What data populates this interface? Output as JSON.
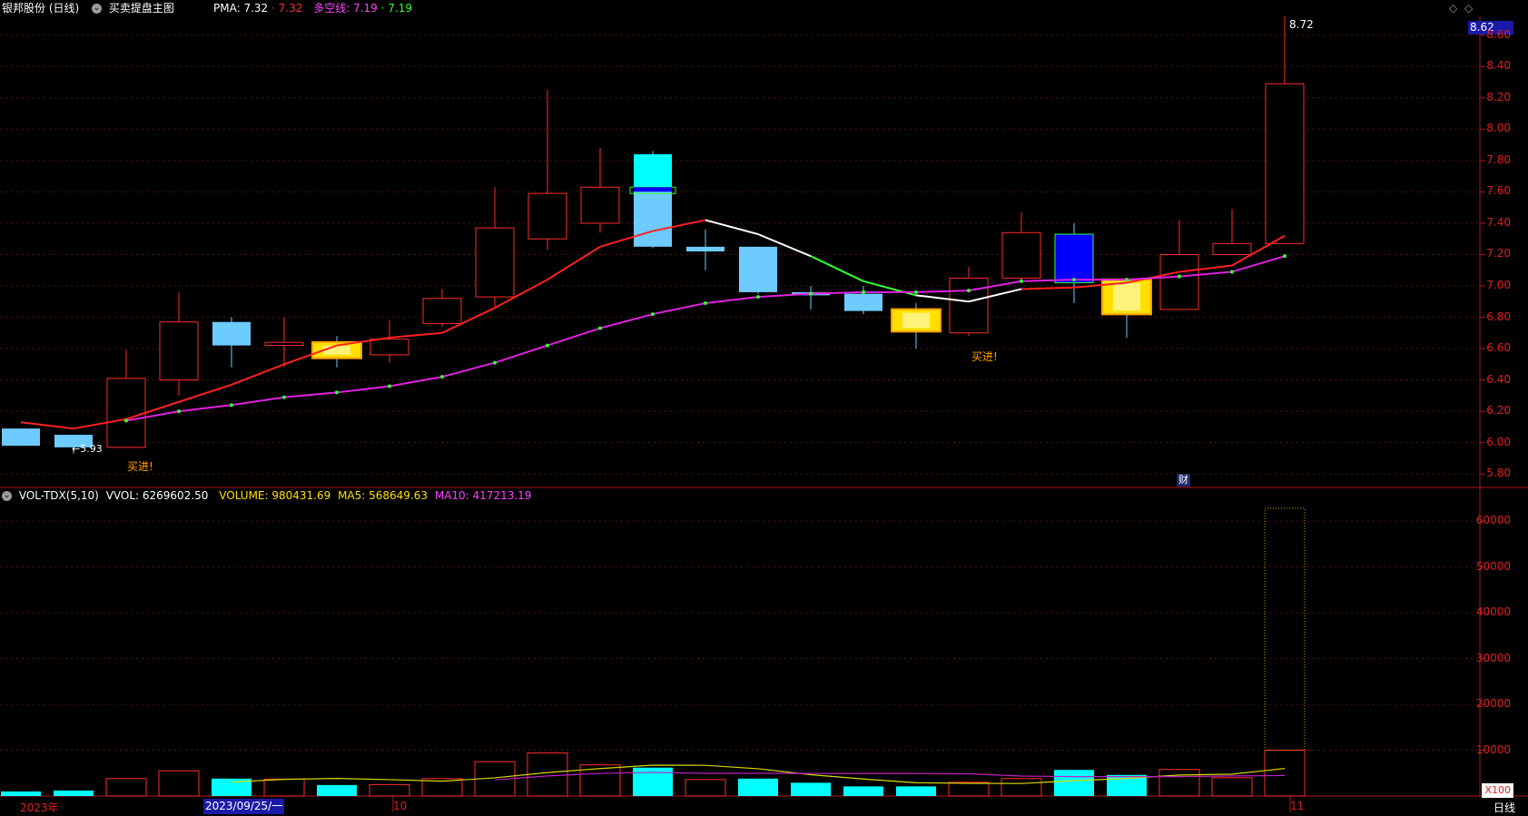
{
  "header": {
    "title": "银邦股份 (日线)",
    "indicator_name": "买卖提盘主图",
    "pma_label": "PMA: 7.32",
    "pma_value": "7.32",
    "dk_label": "多空线: 7.19",
    "dk_value": "7.19"
  },
  "volume_header": {
    "name": "VOL-TDX(5,10)",
    "vvol": "VVOL: 6269602.50",
    "volume": "VOLUME: 980431.69",
    "ma5": "MA5: 568649.63",
    "ma10": "MA10: 417213.19"
  },
  "annotations": {
    "high_label": "8.72",
    "low_label": "←5.93",
    "buy_label": "买进!",
    "cai_label": "财",
    "current_price": "8.62"
  },
  "x_axis": {
    "year_label": "2023年",
    "date_label": "2023/09/25/一",
    "month_oct": "10",
    "month_nov": "11",
    "period_label": "日线",
    "volume_unit": "X100"
  },
  "colors": {
    "up": "#ff2b2b",
    "down": "#6ecbff",
    "cyan": "#00ffff",
    "ma_pma": "#ff2020",
    "ma_dk": "#e020e0",
    "yellow": "#ffe000",
    "blue": "#0000ff",
    "vol_ma5": "#d8d800",
    "vol_ma10": "#c020c0"
  },
  "chart_data": [
    {
      "type": "candlestick",
      "title": "银邦股份 (日线)",
      "y_ticks": [
        5.8,
        6.0,
        6.2,
        6.4,
        6.6,
        6.8,
        7.0,
        7.2,
        7.4,
        7.6,
        7.8,
        8.0,
        8.2,
        8.4,
        8.6
      ],
      "ylim": [
        5.72,
        8.72
      ],
      "candles": [
        {
          "o": 6.09,
          "h": 6.09,
          "l": 5.98,
          "c": 5.98
        },
        {
          "o": 6.05,
          "h": 6.05,
          "l": 5.93,
          "c": 5.97
        },
        {
          "o": 5.97,
          "h": 6.59,
          "l": 5.97,
          "c": 6.41
        },
        {
          "o": 6.4,
          "h": 6.96,
          "l": 6.3,
          "c": 6.77
        },
        {
          "o": 6.77,
          "h": 6.8,
          "l": 6.48,
          "c": 6.62
        },
        {
          "o": 6.62,
          "h": 6.8,
          "l": 6.48,
          "c": 6.64
        },
        {
          "o": 6.63,
          "h": 6.68,
          "l": 6.48,
          "c": 6.55
        },
        {
          "o": 6.56,
          "h": 6.78,
          "l": 6.51,
          "c": 6.66
        },
        {
          "o": 6.76,
          "h": 6.98,
          "l": 6.74,
          "c": 6.92
        },
        {
          "o": 6.93,
          "h": 7.63,
          "l": 6.86,
          "c": 7.37
        },
        {
          "o": 7.3,
          "h": 8.25,
          "l": 7.23,
          "c": 7.59
        },
        {
          "o": 7.4,
          "h": 7.88,
          "l": 7.34,
          "c": 7.63
        },
        {
          "o": 7.84,
          "h": 7.86,
          "l": 7.24,
          "c": 7.25
        },
        {
          "o": 7.25,
          "h": 7.36,
          "l": 7.1,
          "c": 7.22
        },
        {
          "o": 7.25,
          "h": 7.25,
          "l": 6.95,
          "c": 6.96
        },
        {
          "o": 6.96,
          "h": 7.0,
          "l": 6.85,
          "c": 6.94
        },
        {
          "o": 6.95,
          "h": 7.0,
          "l": 6.82,
          "c": 6.84
        },
        {
          "o": 6.84,
          "h": 6.89,
          "l": 6.6,
          "c": 6.72
        },
        {
          "o": 6.7,
          "h": 7.12,
          "l": 6.68,
          "c": 7.05
        },
        {
          "o": 7.05,
          "h": 7.47,
          "l": 7.04,
          "c": 7.34
        },
        {
          "o": 7.33,
          "h": 7.4,
          "l": 6.89,
          "c": 7.02
        },
        {
          "o": 7.03,
          "h": 7.03,
          "l": 6.67,
          "c": 6.83
        },
        {
          "o": 6.85,
          "h": 7.42,
          "l": 6.85,
          "c": 7.2
        },
        {
          "o": 7.2,
          "h": 7.49,
          "l": 7.2,
          "c": 7.27
        },
        {
          "o": 7.27,
          "h": 8.72,
          "l": 7.27,
          "c": 8.29
        }
      ],
      "series": [
        {
          "name": "PMA",
          "values": [
            6.13,
            6.09,
            6.15,
            6.26,
            6.37,
            6.5,
            6.62,
            6.67,
            6.7,
            6.86,
            7.04,
            7.25,
            7.35,
            7.42,
            7.33,
            7.19,
            7.03,
            6.94,
            6.9,
            6.98,
            6.99,
            7.02,
            7.09,
            7.13,
            7.32
          ]
        },
        {
          "name": "多空线",
          "values": [
            null,
            null,
            6.14,
            6.2,
            6.24,
            6.29,
            6.32,
            6.36,
            6.42,
            6.51,
            6.62,
            6.73,
            6.82,
            6.89,
            6.93,
            6.95,
            6.96,
            6.96,
            6.97,
            7.03,
            7.04,
            7.04,
            7.06,
            7.09,
            7.19
          ]
        }
      ]
    },
    {
      "type": "bar",
      "title": "VOL-TDX(5,10)",
      "y_ticks": [
        10000,
        20000,
        30000,
        40000,
        50000,
        60000
      ],
      "ylim": [
        0,
        64000
      ],
      "values": [
        1000,
        1200,
        3800,
        5500,
        3800,
        3700,
        2400,
        2500,
        3800,
        7500,
        9400,
        6800,
        6200,
        3600,
        3800,
        2900,
        2100,
        2100,
        3000,
        3800,
        5700,
        4600,
        5800,
        4000,
        10000
      ],
      "big_bar_high": 62800,
      "direction": [
        "down",
        "down",
        "up",
        "up",
        "down",
        "up",
        "down",
        "up",
        "up",
        "up",
        "up",
        "up",
        "down",
        "up",
        "down",
        "down",
        "down",
        "down",
        "up",
        "up",
        "down",
        "down",
        "up",
        "up",
        "up"
      ],
      "series": [
        {
          "name": "MA5",
          "values": [
            null,
            null,
            null,
            null,
            3060,
            3640,
            3840,
            3580,
            3240,
            3980,
            5120,
            6000,
            6740,
            6700,
            5960,
            4660,
            3720,
            2900,
            2780,
            2740,
            3340,
            3840,
            4580,
            4780,
            6020
          ]
        },
        {
          "name": "MA10",
          "values": [
            null,
            null,
            null,
            null,
            null,
            null,
            null,
            null,
            null,
            3530,
            4380,
            4940,
            5160,
            4960,
            4980,
            4920,
            4930,
            4930,
            4860,
            4360,
            4230,
            4240,
            4240,
            4380,
            4480
          ]
        }
      ]
    }
  ]
}
